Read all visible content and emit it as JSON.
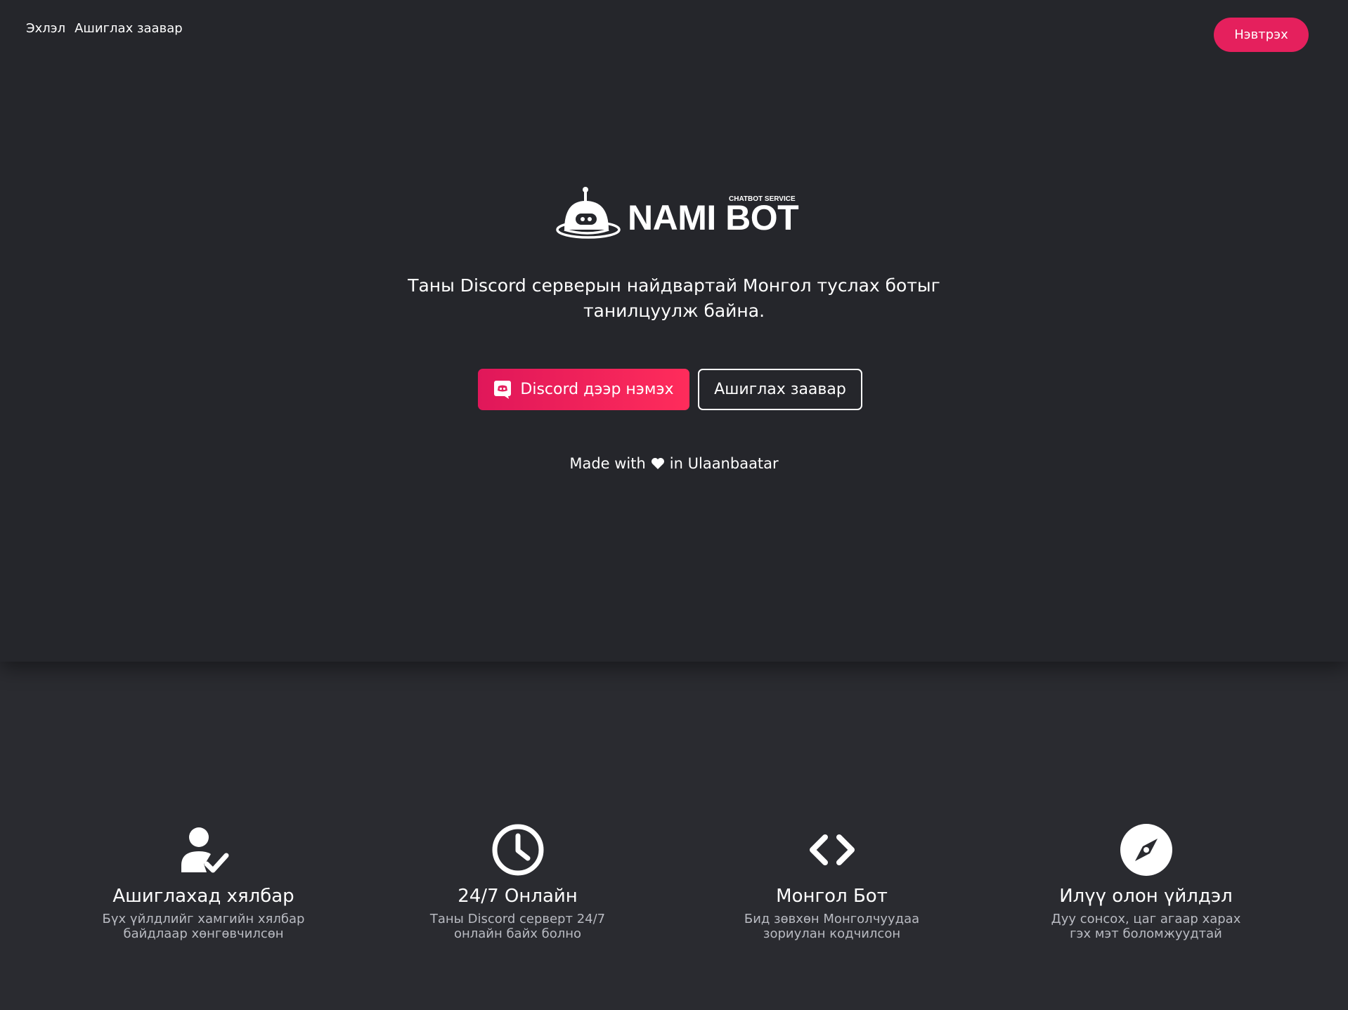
{
  "nav": {
    "home": "Эхлэл",
    "guide": "Ашиглах заавар",
    "login": "Нэвтрэх"
  },
  "logo": {
    "brand": "NAMI BOT",
    "tag": "CHATBOT SERVICE"
  },
  "hero": {
    "tagline": "Таны Discord серверын найдвартай Монгол туслах ботыг танилцуулж байна.",
    "discord_button": "Discord дээр нэмэх",
    "guide_button": "Ашиглах заавар",
    "made_prefix": "Made with",
    "made_suffix": "in Ulaanbaatar"
  },
  "features": [
    {
      "icon": "user-check-icon",
      "title": "Ашиглахад хялбар",
      "desc": "Бүх үйлдлийг хамгийн хялбар байдлаар хөнгөвчилсөн"
    },
    {
      "icon": "clock-icon",
      "title": "24/7 Онлайн",
      "desc": "Таны Discord серверт 24/7 онлайн байх болно"
    },
    {
      "icon": "code-icon",
      "title": "Монгол Бот",
      "desc": "Бид зөвхөн Монголчуудаа зориулан кодчилсон"
    },
    {
      "icon": "compass-icon",
      "title": "Илүү олон үйлдэл",
      "desc": "Дуу сонсох, цаг агаар харах гэх мэт боломжуудтай"
    }
  ],
  "colors": {
    "accent": "#e5205d",
    "hero_bg": "#25262b",
    "page_bg": "#2a2b30",
    "text": "#ffffff",
    "muted_text": "#b9bbc2"
  }
}
